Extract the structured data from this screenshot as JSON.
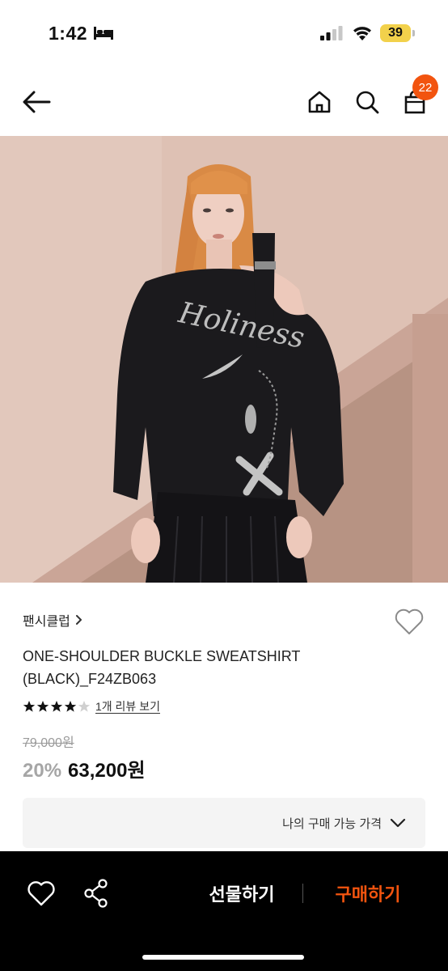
{
  "status_bar": {
    "time": "1:42",
    "battery": "39"
  },
  "nav": {
    "cart_count": "22"
  },
  "product": {
    "brand": "팬시클럽",
    "name_line1": "ONE-SHOULDER BUCKLE SWEATSHIRT",
    "name_line2": "(BLACK)_F24ZB063",
    "rating": 4,
    "rating_max": 5,
    "review_link": "1개 리뷰 보기",
    "original_price": "79,000원",
    "discount": "20%",
    "sale_price": "63,200원",
    "image_print_text": "Holiness"
  },
  "my_price": {
    "label": "나의 구매 가능 가격"
  },
  "bottom_bar": {
    "gift_label": "선물하기",
    "buy_label": "구매하기"
  },
  "colors": {
    "accent": "#f2540f",
    "background_photo": "#dfc3b7",
    "sweatshirt": "#1b1a1d",
    "hair": "#d98a45"
  }
}
